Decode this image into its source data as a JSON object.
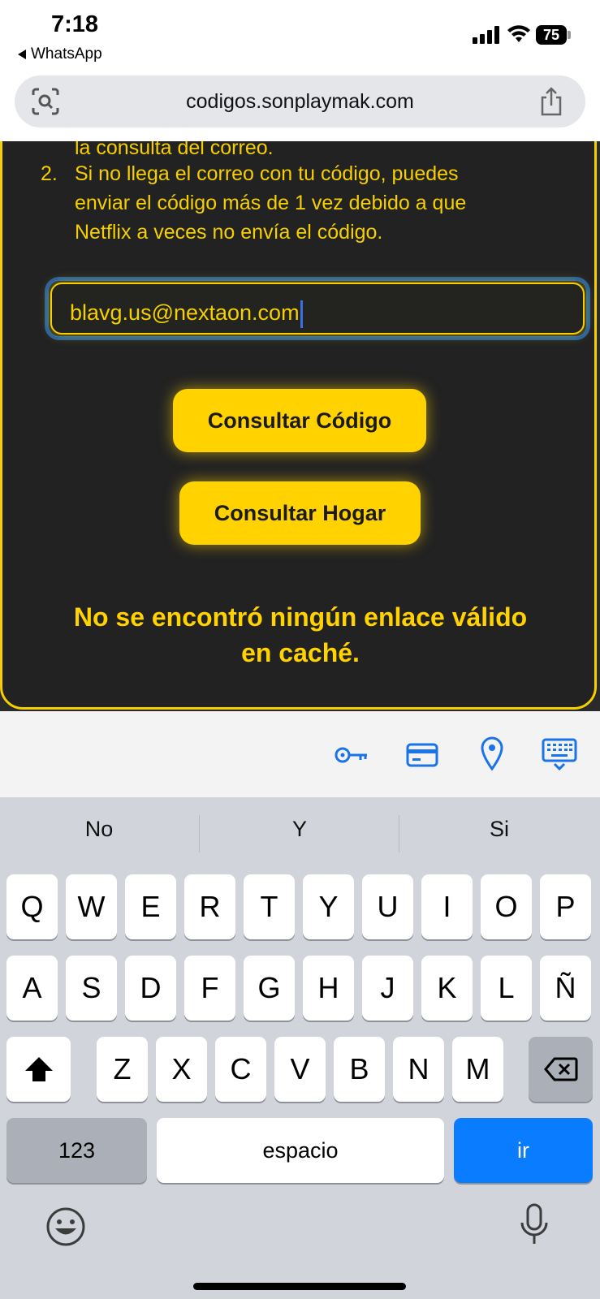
{
  "status_bar": {
    "time": "7:18",
    "back_app": "WhatsApp",
    "battery": "75"
  },
  "browser": {
    "url": "codigos.sonplaymak.com"
  },
  "content": {
    "partial_line": "la consulta del correo.",
    "item2_number": "2.",
    "item2_lines": [
      "Si no llega el correo con tu código, puedes",
      "enviar el código más de 1 vez debido a que",
      "Netflix a veces no envía el código."
    ],
    "email_value": "blavg.us@nextaon.com",
    "btn_code": "Consultar Código",
    "btn_home": "Consultar Hogar",
    "message_lines": [
      "No se encontró ningún enlace válido",
      "en caché."
    ]
  },
  "autofill_icons": [
    "key-icon",
    "card-icon",
    "location-icon",
    "keyboard-icon"
  ],
  "keyboard": {
    "suggestions": [
      "No",
      "Y",
      "Si"
    ],
    "row1": [
      "Q",
      "W",
      "E",
      "R",
      "T",
      "Y",
      "U",
      "I",
      "O",
      "P"
    ],
    "row2": [
      "A",
      "S",
      "D",
      "F",
      "G",
      "H",
      "J",
      "K",
      "L",
      "Ñ"
    ],
    "row3": [
      "Z",
      "X",
      "C",
      "V",
      "B",
      "N",
      "M"
    ],
    "numbers_key": "123",
    "space_key": "espacio",
    "go_key": "ir"
  },
  "colors": {
    "accent_yellow": "#ffd200",
    "card_bg": "#222222",
    "keyboard_bg": "#d1d4da",
    "go_blue": "#0a7cff"
  }
}
